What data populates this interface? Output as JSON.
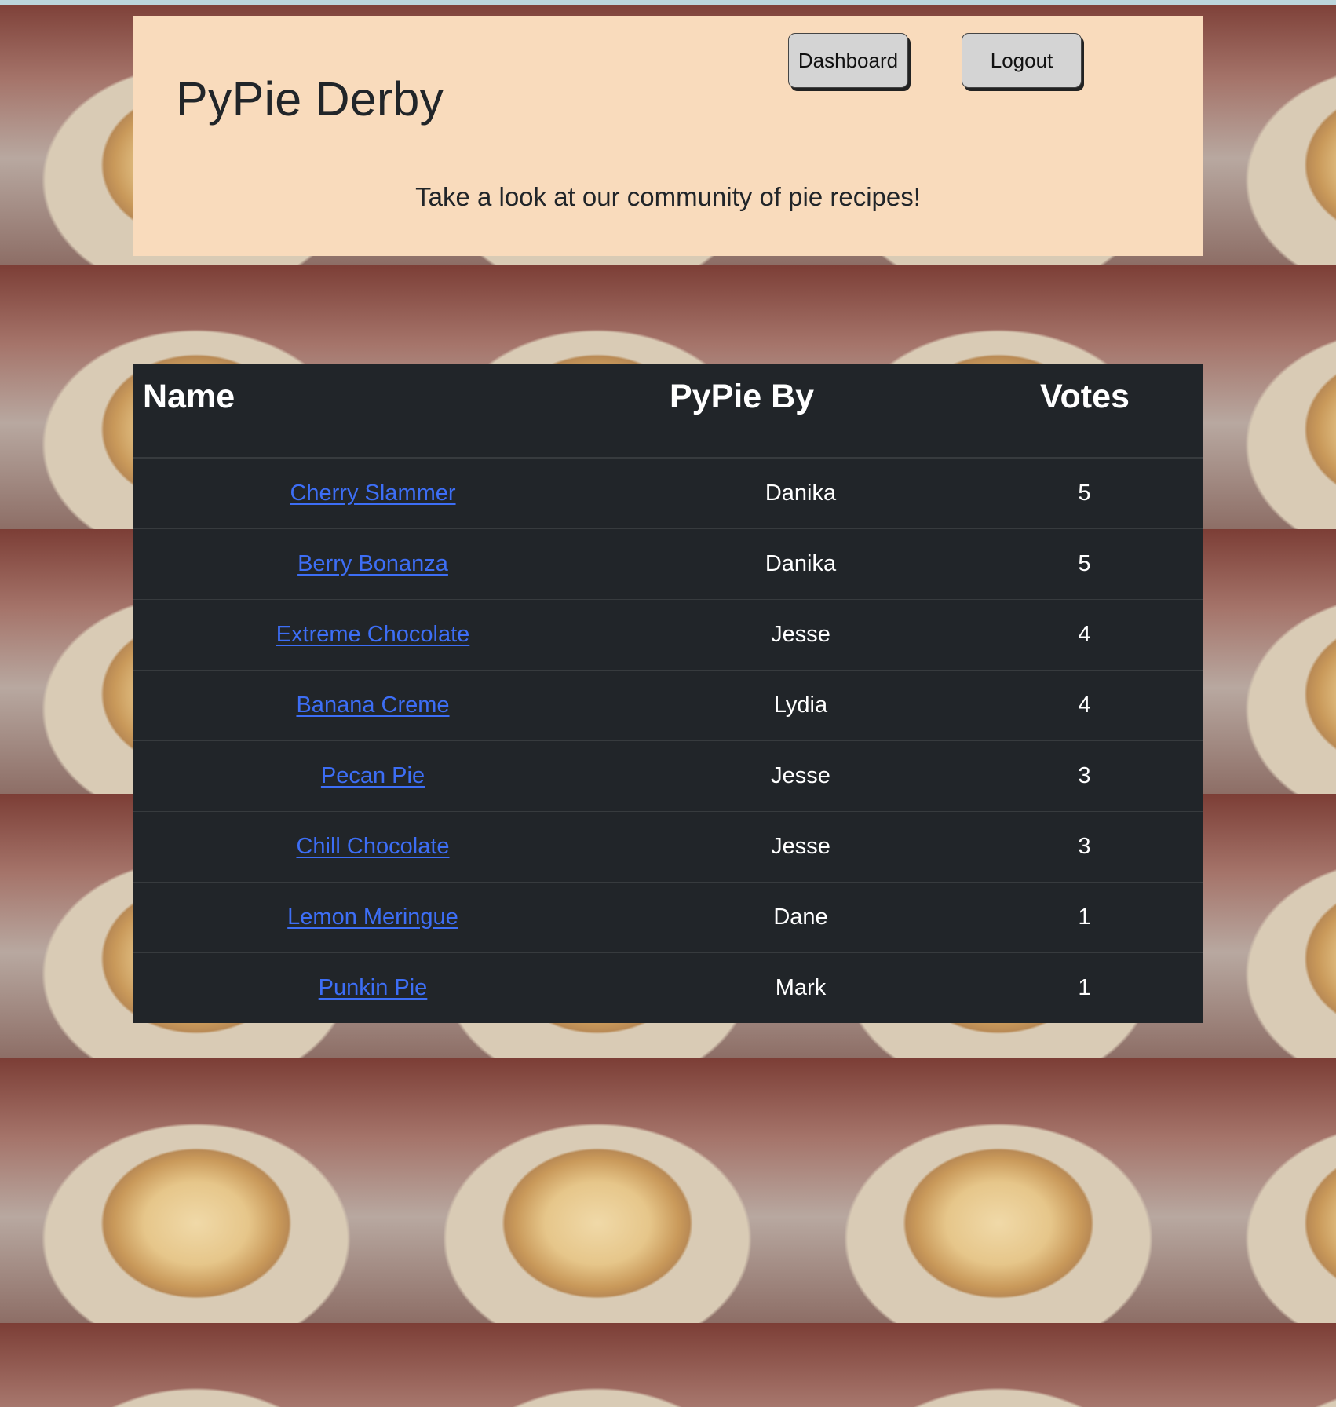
{
  "app": {
    "title": "PyPie Derby",
    "tagline": "Take a look at our community of pie recipes!"
  },
  "nav": {
    "dashboard_label": "Dashboard",
    "logout_label": "Logout"
  },
  "table": {
    "headers": [
      "Name",
      "PyPie By",
      "Votes"
    ],
    "rows": [
      {
        "name": "Cherry Slammer",
        "by": "Danika",
        "votes": "5"
      },
      {
        "name": "Berry Bonanza",
        "by": "Danika",
        "votes": "5"
      },
      {
        "name": "Extreme Chocolate",
        "by": "Jesse",
        "votes": "4"
      },
      {
        "name": "Banana Creme",
        "by": "Lydia",
        "votes": "4"
      },
      {
        "name": "Pecan Pie",
        "by": "Jesse",
        "votes": "3"
      },
      {
        "name": "Chill Chocolate",
        "by": "Jesse",
        "votes": "3"
      },
      {
        "name": "Lemon Meringue",
        "by": "Dane",
        "votes": "1"
      },
      {
        "name": "Punkin Pie",
        "by": "Mark",
        "votes": "1"
      }
    ]
  },
  "colors": {
    "header_bg": "#f9dbbc",
    "table_bg": "#212529",
    "link": "#3d6ef5"
  }
}
